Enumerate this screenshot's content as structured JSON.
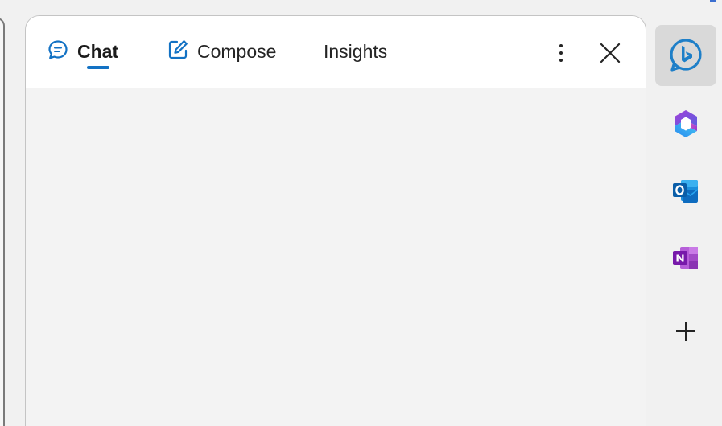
{
  "sidebar_pane": {
    "tabs": [
      {
        "id": "chat",
        "label": "Chat",
        "icon": "chat-bubble-icon",
        "selected": true
      },
      {
        "id": "compose",
        "label": "Compose",
        "icon": "compose-icon",
        "selected": false
      },
      {
        "id": "insights",
        "label": "Insights",
        "selected": false
      }
    ],
    "more_icon": "more-vertical-icon",
    "close_icon": "close-icon"
  },
  "side_apps": [
    {
      "name": "Bing",
      "icon": "bing-chat-icon",
      "active": true
    },
    {
      "name": "Microsoft 365",
      "icon": "microsoft-365-icon",
      "active": false
    },
    {
      "name": "Outlook",
      "icon": "outlook-icon",
      "active": false
    },
    {
      "name": "OneNote",
      "icon": "onenote-icon",
      "active": false
    },
    {
      "name": "Add",
      "icon": "add-icon",
      "active": false
    }
  ],
  "colors": {
    "accent": "#1372c4",
    "bing": "#1e7fc8",
    "outlook": "#0f6cbd",
    "onenote": "#7719aa"
  }
}
